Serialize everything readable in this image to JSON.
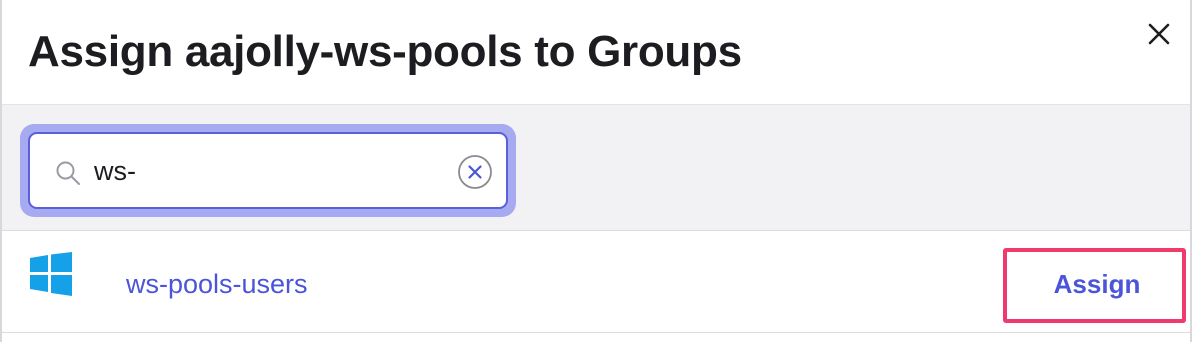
{
  "dialog": {
    "title": "Assign aajolly-ws-pools to Groups"
  },
  "search": {
    "value": "ws-",
    "search_icon": "search-icon",
    "clear_icon": "clear-icon"
  },
  "results": [
    {
      "icon": "windows-icon",
      "name": "ws-pools-users",
      "action_label": "Assign"
    }
  ],
  "colors": {
    "accent": "#4a55d9",
    "focus_ring": "#a6aaf0",
    "highlight": "#ef3a6d",
    "windows_blue": "#14a1e8"
  }
}
